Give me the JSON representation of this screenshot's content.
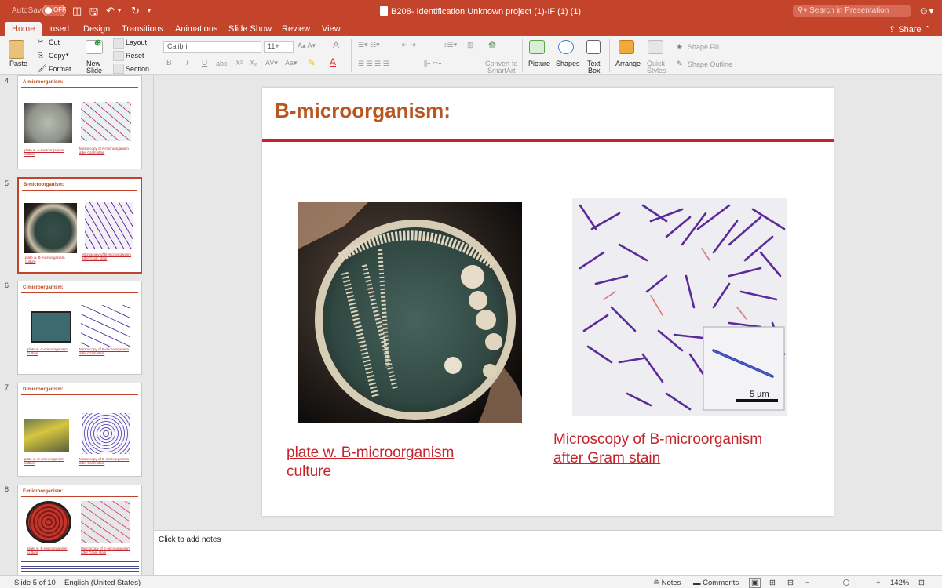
{
  "titlebar": {
    "autosave_label": "AutoSave",
    "autosave_state": "OFF",
    "document_title": "B208- Identification Unknown project (1)-IF (1) (1)",
    "search_placeholder": "Search in Presentation"
  },
  "tabs": [
    "Home",
    "Insert",
    "Design",
    "Transitions",
    "Animations",
    "Slide Show",
    "Review",
    "View"
  ],
  "share_label": "Share",
  "ribbon": {
    "paste": "Paste",
    "cut": "Cut",
    "copy": "Copy",
    "format": "Format",
    "new_slide_1": "New",
    "new_slide_2": "Slide",
    "layout": "Layout",
    "reset": "Reset",
    "section": "Section",
    "font_name": "Calibri",
    "font_size": "11+",
    "convert_1": "Convert to",
    "convert_2": "SmartArt",
    "picture": "Picture",
    "shapes": "Shapes",
    "textbox_1": "Text",
    "textbox_2": "Box",
    "arrange": "Arrange",
    "quick_1": "Quick",
    "quick_2": "Styles",
    "shape_fill": "Shape Fill",
    "shape_outline": "Shape Outline"
  },
  "thumbnails": [
    {
      "num": "4",
      "title": "A-microorganism:",
      "cap_left_1": "plate w. A-microorganism",
      "cap_left_2": "culture",
      "cap_right_1": "Microscopy of A-microorganism",
      "cap_right_2": "after Gram stain"
    },
    {
      "num": "5",
      "title": "B-microorganism:",
      "cap_left_1": "plate w. B-microorganism",
      "cap_left_2": "culture",
      "cap_right_1": "Microscopy of B-microorganism",
      "cap_right_2": "after Gram stain"
    },
    {
      "num": "6",
      "title": "C-microorganism:",
      "cap_left_1": "plate w. C-microorganism",
      "cap_left_2": "culture",
      "cap_right_1": "Microscopy of B-microorganism",
      "cap_right_2": "after Gram stain"
    },
    {
      "num": "7",
      "title": "D-microorganism:",
      "cap_left_1": "plate w. D-microorganism",
      "cap_left_2": "culture",
      "cap_right_1": "Microscopy of D-microorganism",
      "cap_right_2": "after Gram stain"
    },
    {
      "num": "8",
      "title": "E-microorganism:",
      "cap_left_1": "plate w. E-microorganism",
      "cap_left_2": "culture",
      "cap_right_1": "Microscopy of E-microorganism",
      "cap_right_2": "after Gram stain"
    }
  ],
  "slide": {
    "title": "B-microorganism:",
    "left_caption_1": "plate w. B-microorganism",
    "left_caption_2": "culture",
    "right_caption_1": "Microscopy of  B-microorganism",
    "right_caption_2": "after Gram stain",
    "scale_label": "5 µm"
  },
  "notes_placeholder": "Click to add notes",
  "statusbar": {
    "slide_counter": "Slide 5 of 10",
    "language": "English (United States)",
    "notes": "Notes",
    "comments": "Comments",
    "zoom": "142%"
  },
  "colors": {
    "accent": "#c4432b",
    "slide_title": "#b9561f",
    "rule": "#c8232b",
    "caption": "#c8232b"
  }
}
